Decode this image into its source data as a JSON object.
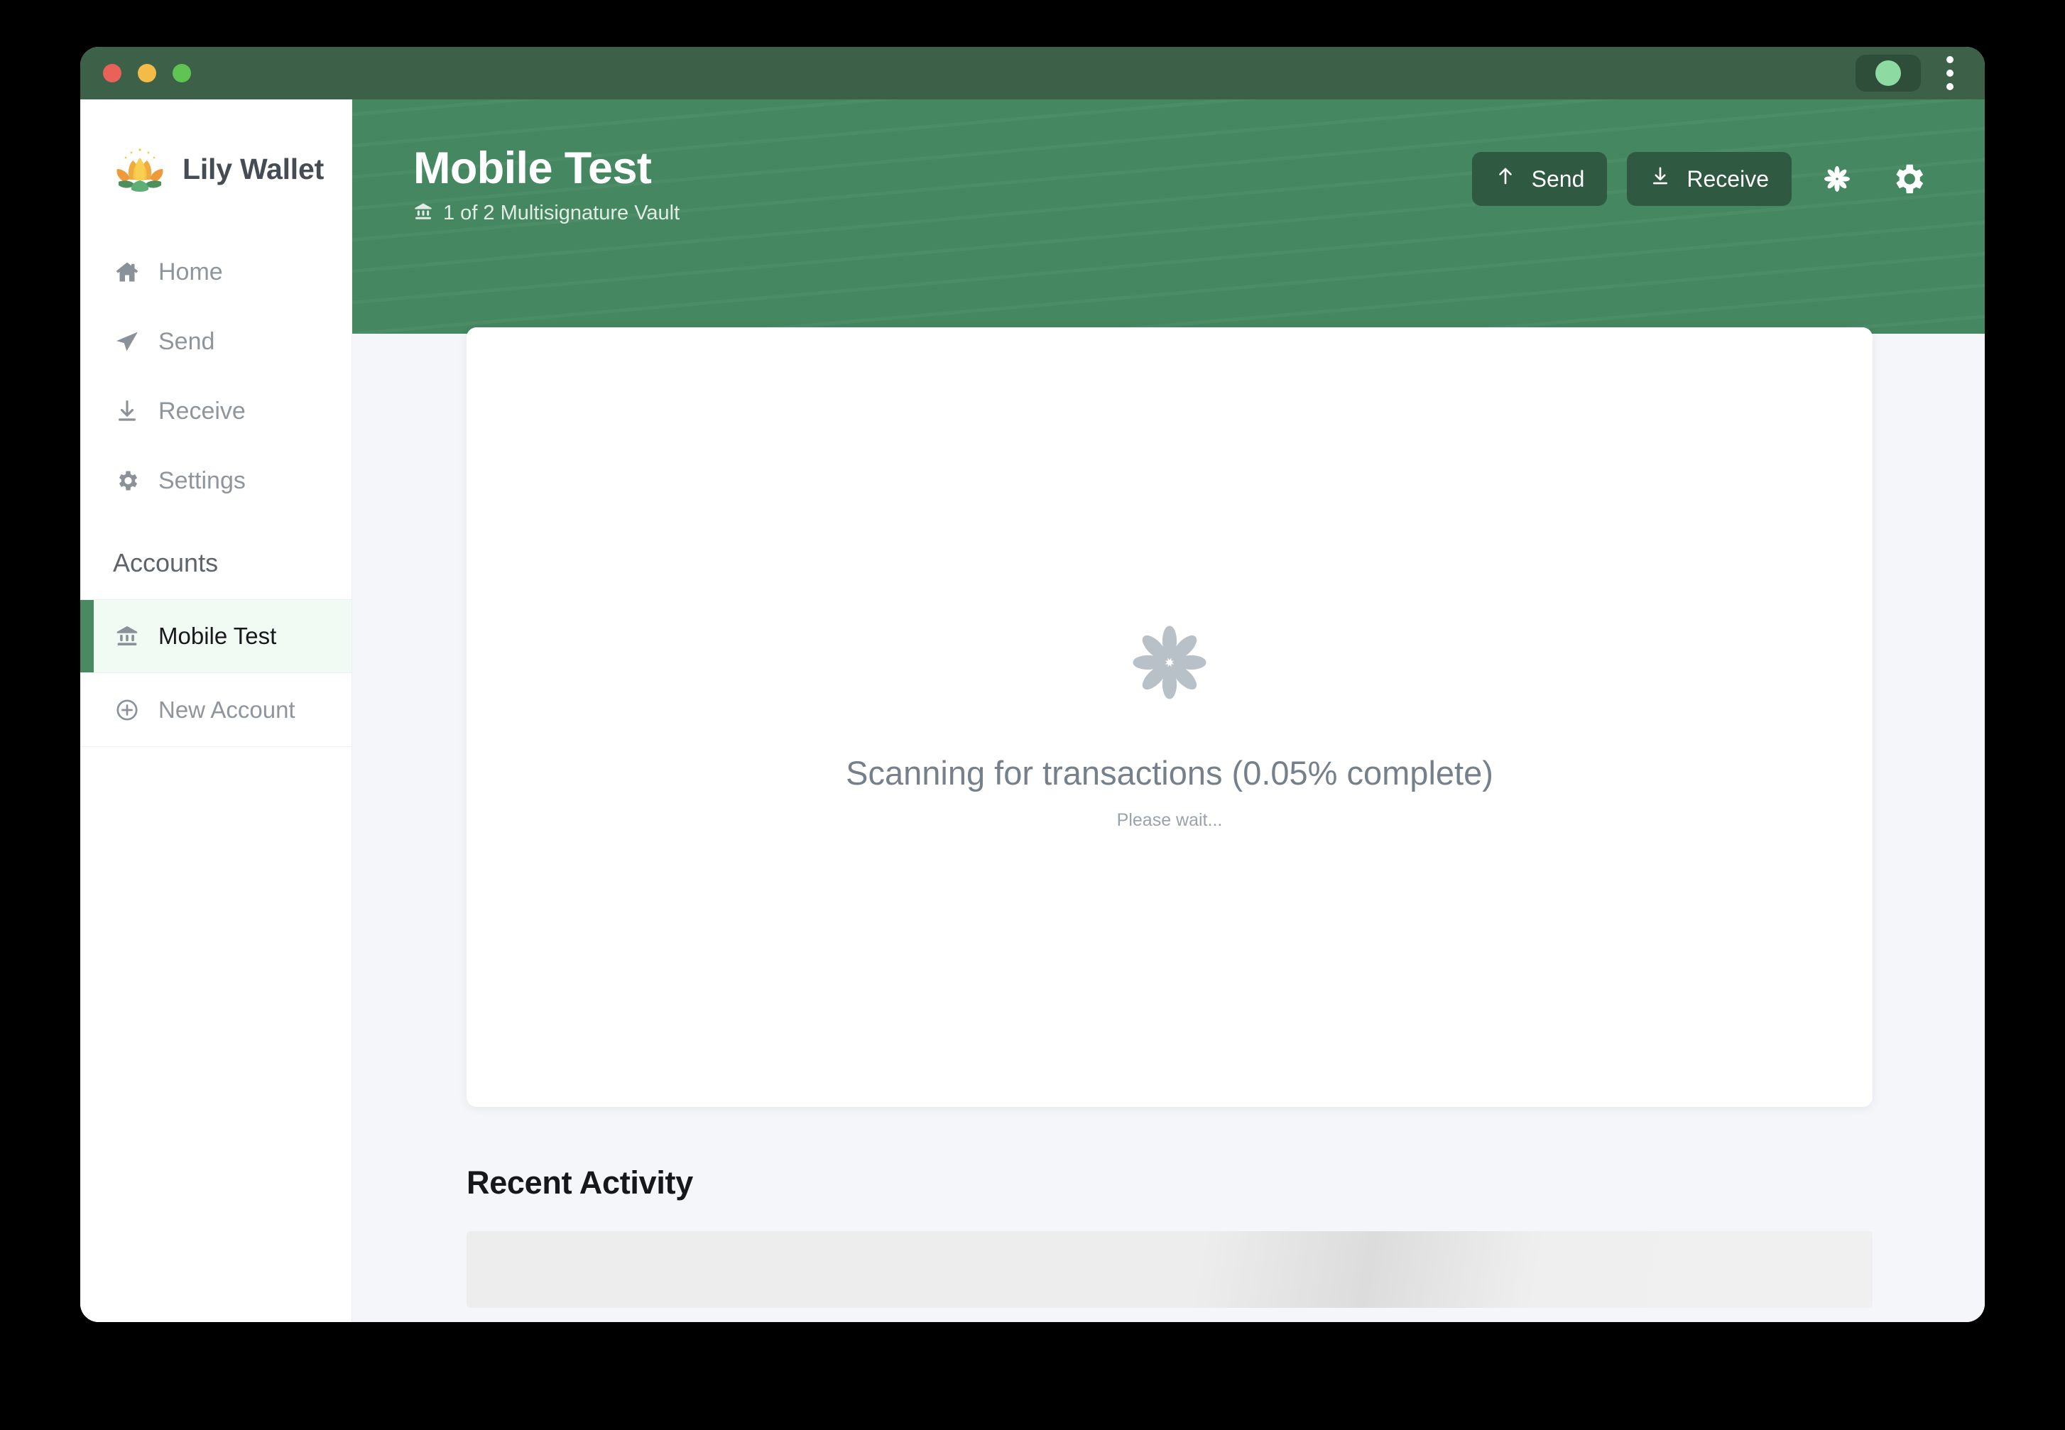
{
  "window": {
    "titlebar": {
      "traffic_lights": [
        "close",
        "minimize",
        "zoom"
      ],
      "status_indicator_color": "#8ddba2",
      "menu_icon": "kebab-menu-icon"
    },
    "background_color": "#3d6049"
  },
  "sidebar": {
    "brand": {
      "name": "Lily Wallet",
      "logo_icon": "lotus-flower-logo"
    },
    "nav_items": [
      {
        "label": "Home",
        "icon": "home-icon"
      },
      {
        "label": "Send",
        "icon": "paper-plane-icon"
      },
      {
        "label": "Receive",
        "icon": "download-arrow-icon"
      },
      {
        "label": "Settings",
        "icon": "gear-icon"
      }
    ],
    "accounts_section_title": "Accounts",
    "accounts": [
      {
        "label": "Mobile Test",
        "icon": "bank-icon",
        "active": true
      },
      {
        "label": "New Account",
        "icon": "plus-circle-icon",
        "active": false
      }
    ]
  },
  "header": {
    "title": "Mobile Test",
    "subtitle": "1 of 2 Multisignature Vault",
    "subtitle_icon": "bank-icon",
    "background_color": "#448760",
    "actions": [
      {
        "label": "Send",
        "icon": "arrow-up-icon"
      },
      {
        "label": "Receive",
        "icon": "arrow-down-line-icon"
      }
    ],
    "icon_buttons": [
      {
        "icon": "lily-flower-icon"
      },
      {
        "icon": "gear-icon"
      }
    ]
  },
  "main": {
    "loading": {
      "spinner_icon": "lily-flower-spinner",
      "title": "Scanning for transactions (0.05% complete)",
      "progress_percent": "0.05%",
      "subtext": "Please wait..."
    },
    "recent_activity": {
      "title": "Recent Activity",
      "skeleton_rows": 2
    }
  },
  "colors": {
    "brand_green": "#448760",
    "titlebar_green": "#3d6049",
    "button_green": "#2f5a41",
    "active_accent": "#4a8a62",
    "active_bg": "#f2faf4",
    "content_bg": "#f4f6fa",
    "muted_text": "#8e959d"
  }
}
